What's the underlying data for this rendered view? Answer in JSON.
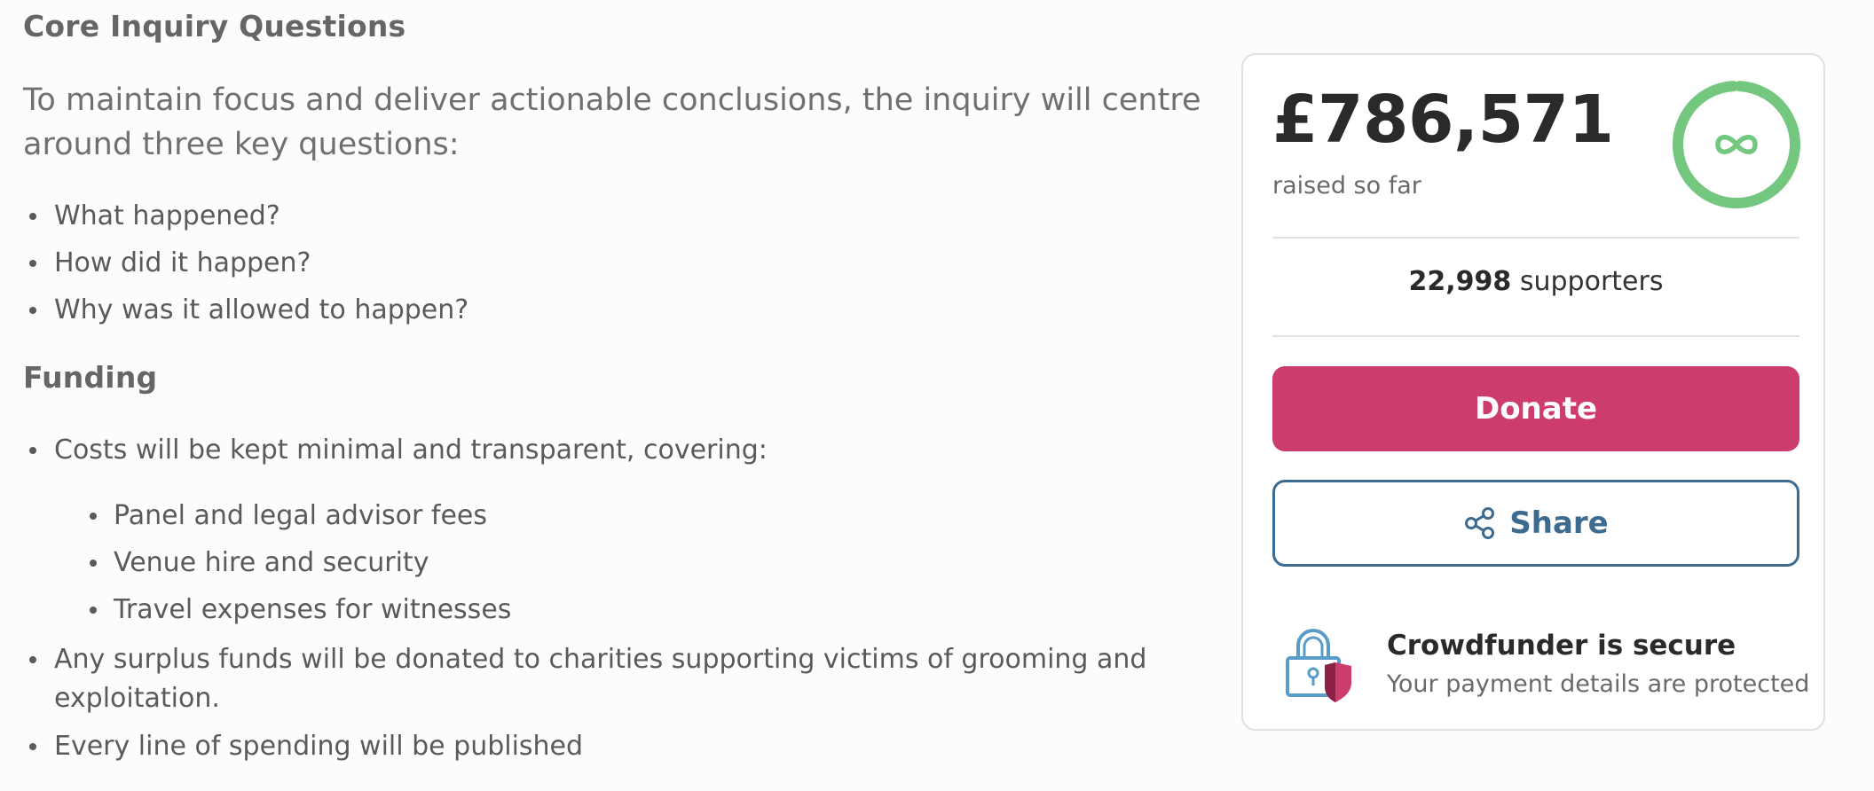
{
  "article": {
    "heading_core": "Core Inquiry Questions",
    "intro": "To maintain focus and deliver actionable conclusions, the inquiry will centre around three key questions:",
    "questions": [
      "What happened?",
      "How did it happen?",
      "Why was it allowed to happen?"
    ],
    "heading_funding": "Funding",
    "funding_costs": "Costs will be kept minimal and transparent, covering:",
    "funding_cost_items": [
      "Panel and legal advisor fees",
      "Venue hire and security",
      "Travel expenses for witnesses"
    ],
    "funding_surplus": "Any surplus funds will be donated to charities supporting victims of grooming and exploitation.",
    "funding_published": "Every line of spending will be published"
  },
  "card": {
    "amount": "£786,571",
    "raised_label": "raised so far",
    "progress_icon": "infinity-icon",
    "supporters_count": "22,998",
    "supporters_label": "supporters",
    "donate_label": "Donate",
    "share_label": "Share",
    "share_icon": "share-icon",
    "secure_title": "Crowdfunder is secure",
    "secure_subtitle": "Your payment details are protected",
    "secure_icon": "padlock-shield-icon"
  },
  "colors": {
    "accent_pink": "#cc3d6b",
    "share_blue": "#3d6b90",
    "progress_green": "#74c77f"
  }
}
